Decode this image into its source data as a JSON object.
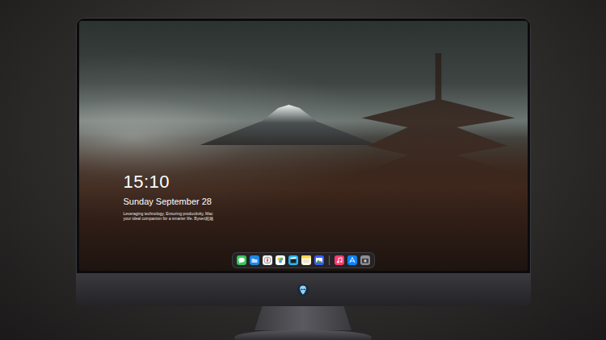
{
  "lock_screen": {
    "time": "15:10",
    "date": "Sunday September 28",
    "tagline": [
      "Leveraging technology, Ensuring productivity, Mac",
      "your ideal companion for a smarter life. Bysen超越"
    ]
  }
}
